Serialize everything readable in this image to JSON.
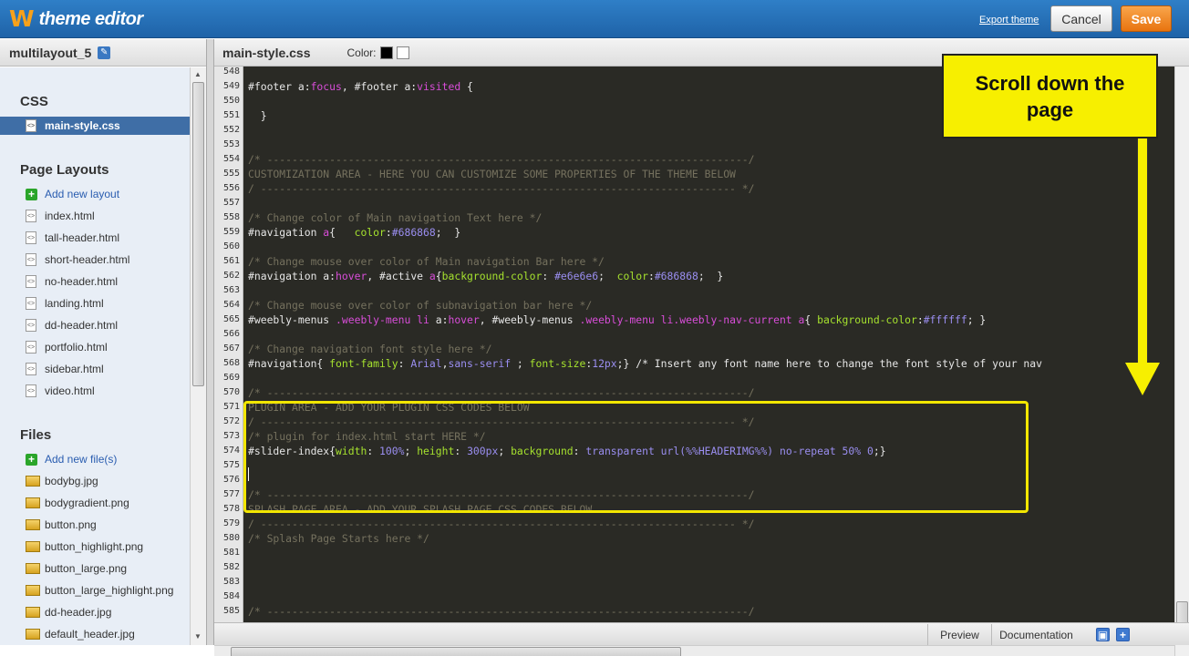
{
  "app": {
    "logo_mark": "W",
    "title": "theme editor",
    "export_label": "Export theme",
    "cancel_label": "Cancel",
    "save_label": "Save"
  },
  "sidebar": {
    "site_name": "multilayout_5",
    "css": {
      "title": "CSS",
      "items": [
        "main-style.css"
      ]
    },
    "layouts": {
      "title": "Page Layouts",
      "add_label": "Add new layout",
      "items": [
        "index.html",
        "tall-header.html",
        "short-header.html",
        "no-header.html",
        "landing.html",
        "dd-header.html",
        "portfolio.html",
        "sidebar.html",
        "video.html"
      ]
    },
    "files": {
      "title": "Files",
      "add_label": "Add new file(s)",
      "items": [
        "bodybg.jpg",
        "bodygradient.png",
        "button.png",
        "button_highlight.png",
        "button_large.png",
        "button_large_highlight.png",
        "dd-header.jpg",
        "default_header.jpg"
      ]
    }
  },
  "editor": {
    "file_name": "main-style.css",
    "color_label": "Color:",
    "colors": {
      "black": "#000000",
      "white": "#ffffff",
      "highlight": "#f2e600"
    },
    "lines": [
      {
        "n": "548",
        "t": ""
      },
      {
        "n": "549",
        "t": "#footer a:focus, #footer a:visited {"
      },
      {
        "n": "550",
        "t": ""
      },
      {
        "n": "551",
        "t": "  }"
      },
      {
        "n": "552",
        "t": ""
      },
      {
        "n": "553",
        "t": ""
      },
      {
        "n": "554",
        "t": "/* -----------------------------------------------------------------------------/"
      },
      {
        "n": "555",
        "t": "CUSTOMIZATION AREA - HERE YOU CAN CUSTOMIZE SOME PROPERTIES OF THE THEME BELOW"
      },
      {
        "n": "556",
        "t": "/ ---------------------------------------------------------------------------- */"
      },
      {
        "n": "557",
        "t": ""
      },
      {
        "n": "558",
        "t": "/* Change color of Main navigation Text here */"
      },
      {
        "n": "559",
        "t": "#navigation a{   color:#686868;  }"
      },
      {
        "n": "560",
        "t": ""
      },
      {
        "n": "561",
        "t": "/* Change mouse over color of Main navigation Bar here */"
      },
      {
        "n": "562",
        "t": "#navigation a:hover, #active a{background-color: #e6e6e6;  color:#686868;  }"
      },
      {
        "n": "563",
        "t": ""
      },
      {
        "n": "564",
        "t": "/* Change mouse over color of subnavigation bar here */"
      },
      {
        "n": "565",
        "t": "#weebly-menus .weebly-menu li a:hover, #weebly-menus .weebly-menu li.weebly-nav-current a{ background-color:#ffffff; }"
      },
      {
        "n": "566",
        "t": ""
      },
      {
        "n": "567",
        "t": "/* Change navigation font style here */"
      },
      {
        "n": "568",
        "t": "#navigation{ font-family: Arial,sans-serif ; font-size:12px;} /* Insert any font name here to change the font style of your nav"
      },
      {
        "n": "569",
        "t": ""
      },
      {
        "n": "570",
        "t": "/* -----------------------------------------------------------------------------/"
      },
      {
        "n": "571",
        "t": "PLUGIN AREA - ADD YOUR PLUGIN CSS CODES BELOW"
      },
      {
        "n": "572",
        "t": "/ ---------------------------------------------------------------------------- */"
      },
      {
        "n": "573",
        "t": "/* plugin for index.html start HERE */"
      },
      {
        "n": "574",
        "t": "#slider-index{width: 100%; height: 300px; background: transparent url(%%HEADERIMG%%) no-repeat 50% 0;}"
      },
      {
        "n": "575",
        "t": ""
      },
      {
        "n": "576",
        "t": ""
      },
      {
        "n": "577",
        "t": "/* -----------------------------------------------------------------------------/"
      },
      {
        "n": "578",
        "t": "SPLASH PAGE AREA - ADD YOUR SPLASH PAGE CSS CODES BELOW"
      },
      {
        "n": "579",
        "t": "/ ---------------------------------------------------------------------------- */"
      },
      {
        "n": "580",
        "t": "/* Splash Page Starts here */"
      },
      {
        "n": "581",
        "t": ""
      },
      {
        "n": "582",
        "t": ""
      },
      {
        "n": "583",
        "t": ""
      },
      {
        "n": "584",
        "t": ""
      },
      {
        "n": "585",
        "t": "/* -----------------------------------------------------------------------------/"
      }
    ],
    "callout": "Scroll down the page",
    "preview_label": "Preview",
    "documentation_label": "Documentation"
  }
}
